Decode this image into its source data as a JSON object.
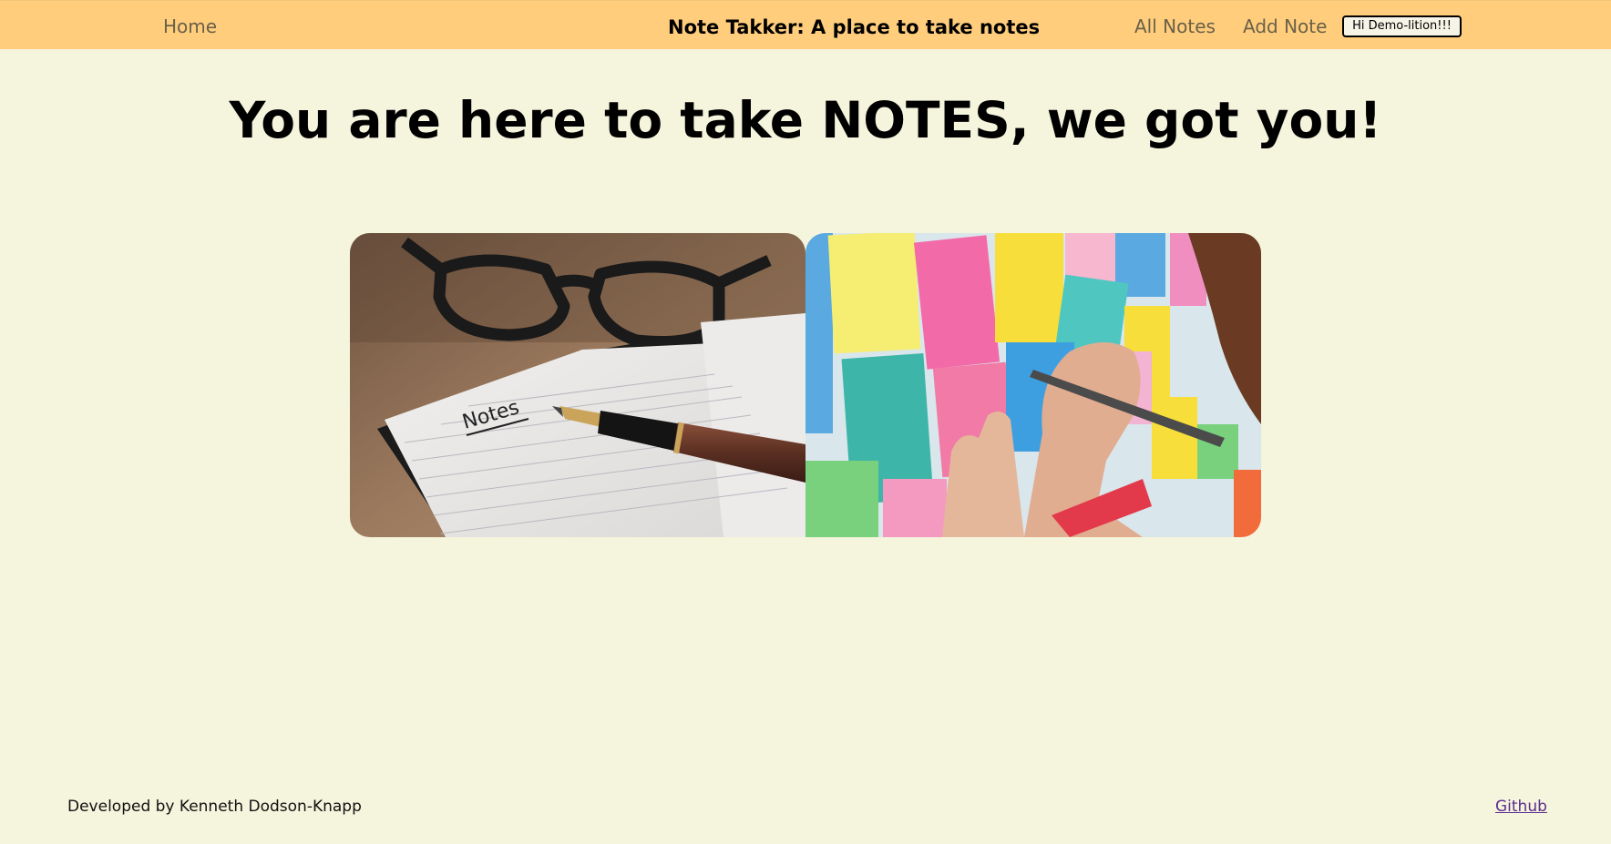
{
  "nav": {
    "home_label": "Home",
    "brand_title": "Note Takker: A place to take notes",
    "all_notes_label": "All Notes",
    "add_note_label": "Add Note",
    "user_button_label": "Hi Demo-lition!!!"
  },
  "main": {
    "heading": "You are here to take NOTES, we got you!",
    "images": [
      {
        "subject": "notebook-with-pen-and-glasses",
        "handwritten_text": "Notes"
      },
      {
        "subject": "hand-writing-on-sticky-notes-wall"
      }
    ]
  },
  "footer": {
    "credit": "Developed by Kenneth Dodson-Knapp",
    "github_label": "Github"
  },
  "colors": {
    "navbar_bg": "#ffcd7c",
    "page_bg": "#f5f4dc",
    "nav_link_text": "#6a6048",
    "footer_link": "#5b2d8e"
  }
}
